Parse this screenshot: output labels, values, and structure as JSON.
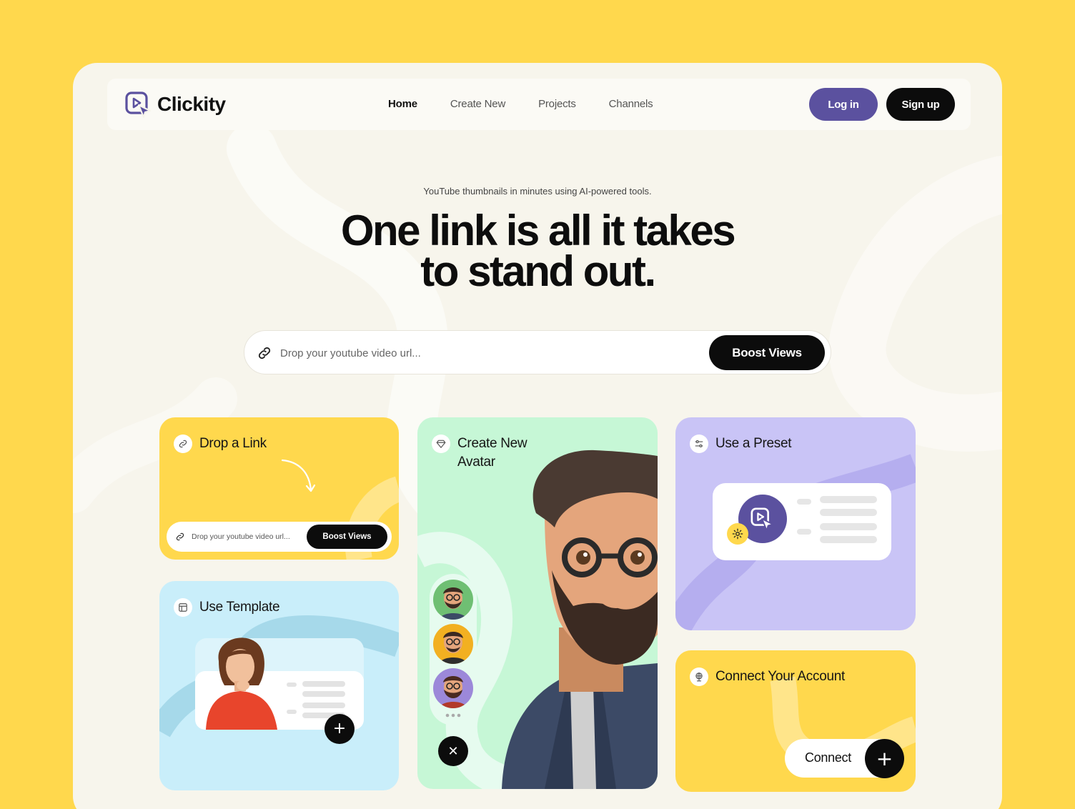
{
  "brand": {
    "name": "Clickity",
    "color": "#5B519F"
  },
  "nav": {
    "links": [
      "Home",
      "Create New",
      "Projects",
      "Channels"
    ],
    "active": "Home",
    "login_label": "Log in",
    "signup_label": "Sign up"
  },
  "hero": {
    "subtitle": "YouTube thumbnails in minutes using AI-powered tools.",
    "title_line1": "One link is all it takes",
    "title_line2": "to stand out."
  },
  "search": {
    "placeholder": "Drop your youtube video url...",
    "button_label": "Boost Views"
  },
  "cards": {
    "drop": {
      "title": "Drop a Link",
      "placeholder": "Drop your youtube video url...",
      "button_label": "Boost Views",
      "icon": "link-icon"
    },
    "template": {
      "title": "Use Template",
      "icon": "template-icon"
    },
    "avatar": {
      "title_line1": "Create New",
      "title_line2": "Avatar",
      "icon": "diamond-icon",
      "thumbnail_colors": [
        "#6FBF73",
        "#F2B021",
        "#9C88D9"
      ]
    },
    "preset": {
      "title": "Use a Preset",
      "icon": "sliders-icon"
    },
    "connect": {
      "title": "Connect Your Account",
      "button_label": "Connect",
      "icon": "globe-icon"
    }
  },
  "colors": {
    "background": "#FFD84D",
    "frame": "#F7F5EC",
    "accent_purple": "#5B519F",
    "drop_card": "#FFD84D",
    "template_card": "#C9EEFA",
    "avatar_card": "#C6F7D6",
    "preset_card": "#C9C4F6",
    "connect_card": "#FFD84D"
  }
}
